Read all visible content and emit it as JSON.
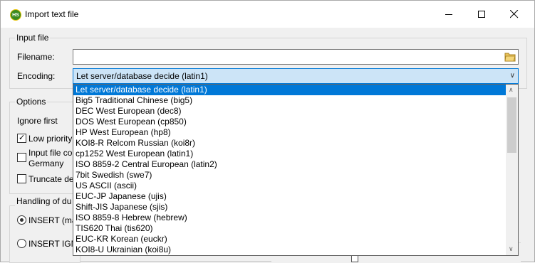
{
  "window": {
    "title": "Import text file",
    "icon_text": "HS"
  },
  "input_file": {
    "group_title": "Input file",
    "filename_label": "Filename:",
    "filename_value": "",
    "encoding_label": "Encoding:",
    "encoding_value": "Let server/database decide (latin1)"
  },
  "options": {
    "group_title": "Options",
    "ignore_first_label": "Ignore first",
    "low_priority_label": "Low priority",
    "input_file_co_label": "Input file co",
    "germany_label": "Germany",
    "truncate_label": "Truncate de"
  },
  "handling": {
    "group_title": "Handling of du",
    "insert_label": "INSERT (may",
    "insert_ignore_label": "INSERT IGNO"
  },
  "encoding_options": [
    "Let server/database decide (latin1)",
    "Big5 Traditional Chinese (big5)",
    "DEC West European (dec8)",
    "DOS West European (cp850)",
    "HP West European (hp8)",
    "KOI8-R Relcom Russian (koi8r)",
    "cp1252 West European (latin1)",
    "ISO 8859-2 Central European (latin2)",
    "7bit Swedish (swe7)",
    "US ASCII (ascii)",
    "EUC-JP Japanese (ujis)",
    "Shift-JIS Japanese (sjis)",
    "ISO 8859-8 Hebrew (hebrew)",
    "TIS620 Thai (tis620)",
    "EUC-KR Korean (euckr)",
    "KOI8-U Ukrainian (koi8u)"
  ],
  "colors": {
    "selection": "#0078d7",
    "select_bg": "#cce4f7"
  }
}
